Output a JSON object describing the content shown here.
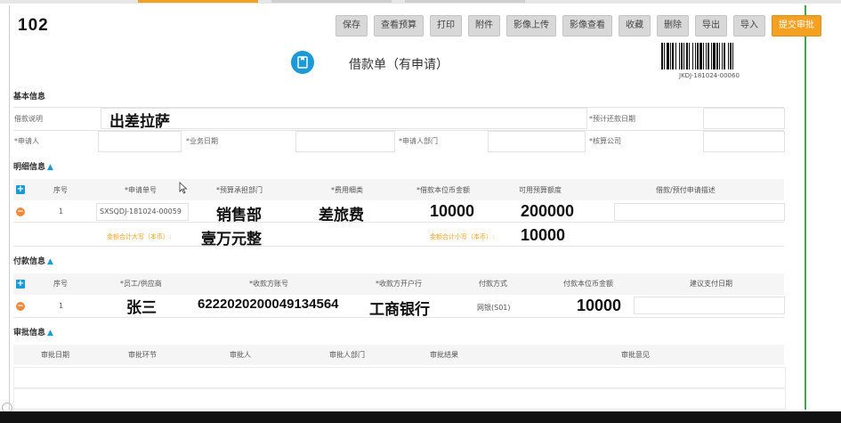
{
  "doc": {
    "number": "102"
  },
  "toolbar": {
    "buttons": [
      "保存",
      "查看预算",
      "打印",
      "附件",
      "影像上传",
      "影像查看",
      "收藏",
      "删除",
      "导出",
      "导入"
    ],
    "submit": "提交审批"
  },
  "form": {
    "title": "借款单（有申请）",
    "barcode_text": "JKDJ-181024-00060"
  },
  "basic": {
    "section": "基本信息",
    "desc_label": "借款说明",
    "desc_value": "出差拉萨",
    "repay_date_label": "*预计还款日期",
    "applicant_label": "*申请人",
    "biz_date_label": "*业务日期",
    "dept_label": "*申请人部门",
    "company_label": "*核算公司"
  },
  "detail": {
    "section": "明细信息",
    "headers": [
      "序号",
      "*申请单号",
      "*预算承担部门",
      "*费用细类",
      "*借款本位币金额",
      "可用预算额度",
      "借款/预付申请描述"
    ],
    "row": {
      "seq": "1",
      "app_no": "SXSQDJ-181024-00059",
      "dept": "销售部",
      "fee_type": "差旅费",
      "amount": "10000",
      "budget": "200000",
      "desc": ""
    },
    "total_upper_label": "金额合计大写（本币）:",
    "total_upper_value": "壹万元整",
    "total_lower_label": "金额合计小写（本币）:",
    "total_lower_value": "10000"
  },
  "payment": {
    "section": "付款信息",
    "headers": [
      "序号",
      "*员工/供应商",
      "*收款方账号",
      "*收款方开户行",
      "付款方式",
      "付款本位币金额",
      "建议支付日期"
    ],
    "row": {
      "seq": "1",
      "payee": "张三",
      "account": "6222020200049134564",
      "bank": "工商银行",
      "method": "网银(S01)",
      "amount": "10000",
      "date": ""
    }
  },
  "approval": {
    "section": "审批信息",
    "headers": [
      "审批日期",
      "审批环节",
      "审批人",
      "审批人部门",
      "审批结果",
      "审批意见"
    ]
  },
  "colors": {
    "accent": "#1c9ad6",
    "submit": "#f4a021",
    "delete": "#f08a3c"
  }
}
